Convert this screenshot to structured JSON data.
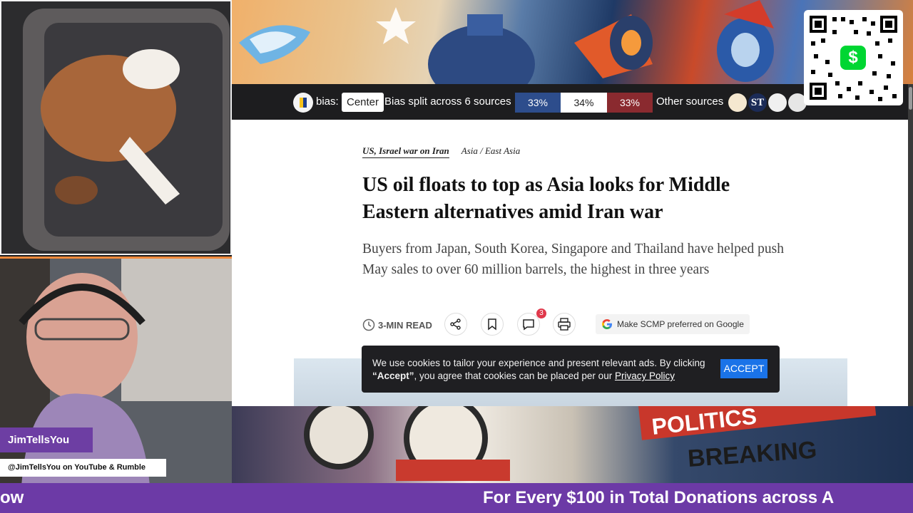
{
  "bias_bar": {
    "bias_label": "bias:",
    "bias_value": "Center",
    "split_text": "Bias split across 6 sources",
    "left_pct": "33%",
    "center_pct": "34%",
    "right_pct": "33%",
    "other_sources": "Other sources",
    "colors": {
      "left": "#2d4d8c",
      "center": "#ffffff",
      "right": "#8a2a2f"
    }
  },
  "article": {
    "section": "US, Israel war on Iran",
    "category": "Asia / East Asia",
    "headline": "US oil floats to top as Asia looks for Middle Eastern alternatives amid Iran war",
    "subhead": "Buyers from Japan, South Korea, Singapore and Thailand have helped push May sales to over 60 million barrels, the highest in three years",
    "read_time": "3-MIN READ",
    "comments_count": "3",
    "preferred_label": "Make SCMP preferred on Google"
  },
  "cookie_banner": {
    "text_before": "We use cookies to tailor your experience and present relevant ads. By clicking ",
    "accept_word": "“Accept”",
    "text_after": ", you agree that cookies can be placed per our ",
    "policy_link": "Privacy Policy",
    "accept_button": "ACCEPT"
  },
  "qr": {
    "icon": "cashapp-dollar-icon",
    "symbol": "$"
  },
  "stream": {
    "host_name": "JimTellsYou",
    "handle": "@JimTellsYou on YouTube & Rumble",
    "ticker_left": "ow",
    "ticker_main": "For Every $100 in Total Donations across A"
  }
}
